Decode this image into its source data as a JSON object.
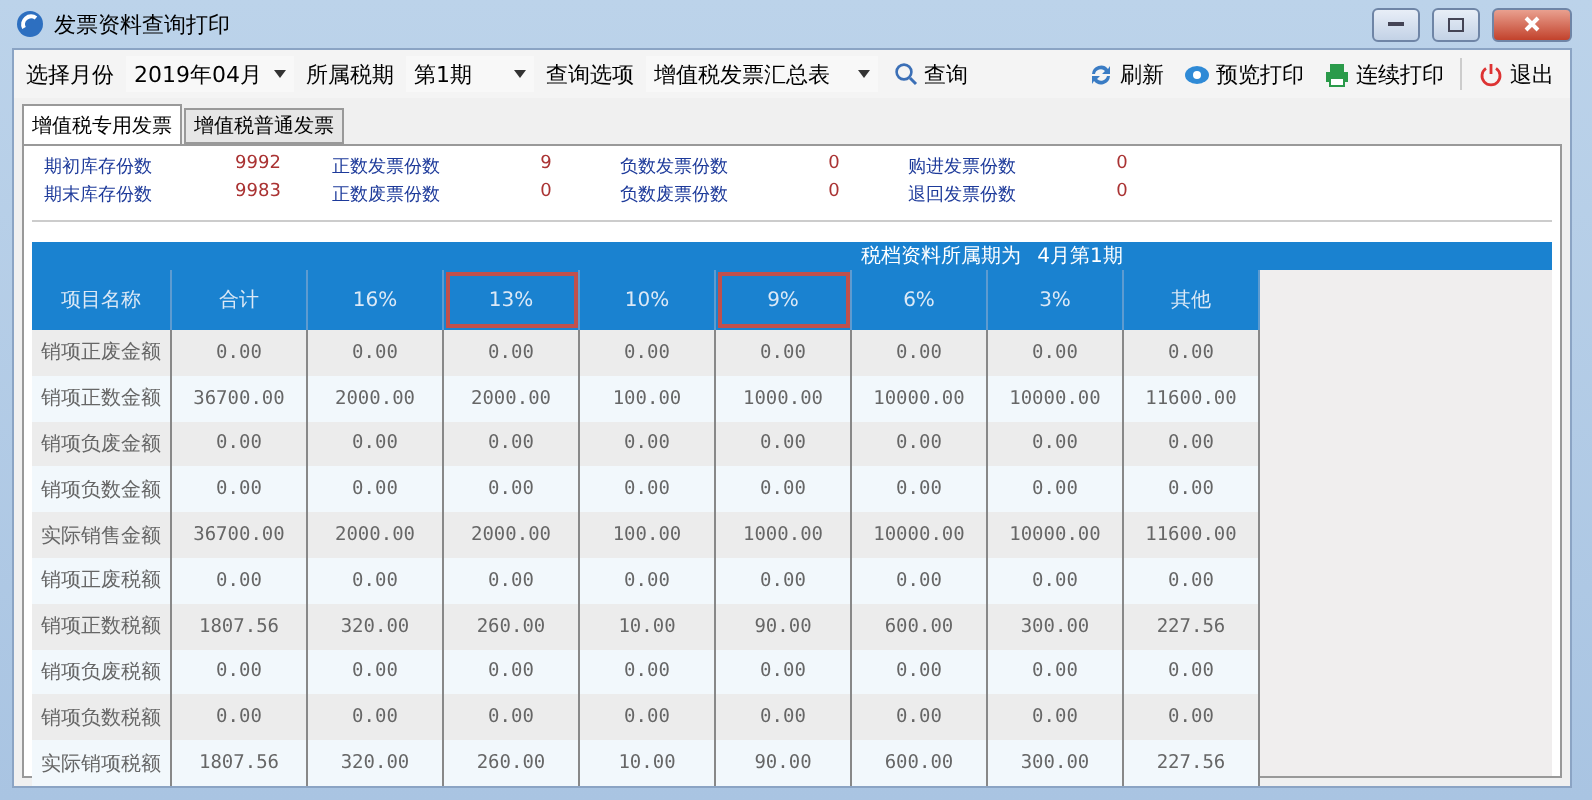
{
  "window": {
    "title": "发票资料查询打印"
  },
  "toolbar": {
    "month_label": "选择月份",
    "month": "2019年04月",
    "period_label": "所属税期",
    "period": "第1期",
    "option_label": "查询选项",
    "option": "增值税发票汇总表",
    "query": "查询",
    "actions": [
      {
        "kind": "refresh",
        "label": "刷新"
      },
      {
        "kind": "preview",
        "label": "预览打印"
      },
      {
        "kind": "print",
        "label": "连续打印"
      },
      {
        "kind": "exit",
        "label": "退出"
      }
    ]
  },
  "tabs": [
    {
      "label": "增值税专用发票",
      "selected": true
    },
    {
      "label": "增值税普通发票",
      "selected": false
    }
  ],
  "summary": [
    [
      {
        "label": "期初库存份数",
        "value": "9992"
      },
      {
        "label": "正数发票份数",
        "value": "9"
      },
      {
        "label": "负数发票份数",
        "value": "0"
      },
      {
        "label": "购进发票份数",
        "value": "0"
      }
    ],
    [
      {
        "label": "期末库存份数",
        "value": "9983"
      },
      {
        "label": "正数废票份数",
        "value": "0"
      },
      {
        "label": "负数废票份数",
        "value": "0"
      },
      {
        "label": "退回发票份数",
        "value": "0"
      }
    ]
  ],
  "table": {
    "caption": "税档资料所属期为",
    "period": "4月第1期",
    "columns": [
      {
        "label": "项目名称",
        "highlighted": false
      },
      {
        "label": "合计",
        "highlighted": false
      },
      {
        "label": "16%",
        "highlighted": false
      },
      {
        "label": "13%",
        "highlighted": true
      },
      {
        "label": "10%",
        "highlighted": false
      },
      {
        "label": "9%",
        "highlighted": true
      },
      {
        "label": "6%",
        "highlighted": false
      },
      {
        "label": "3%",
        "highlighted": false
      },
      {
        "label": "其他",
        "highlighted": false
      }
    ],
    "rows": [
      [
        "销项正废金额",
        "0.00",
        "0.00",
        "0.00",
        "0.00",
        "0.00",
        "0.00",
        "0.00",
        "0.00"
      ],
      [
        "销项正数金额",
        "36700.00",
        "2000.00",
        "2000.00",
        "100.00",
        "1000.00",
        "10000.00",
        "10000.00",
        "11600.00"
      ],
      [
        "销项负废金额",
        "0.00",
        "0.00",
        "0.00",
        "0.00",
        "0.00",
        "0.00",
        "0.00",
        "0.00"
      ],
      [
        "销项负数金额",
        "0.00",
        "0.00",
        "0.00",
        "0.00",
        "0.00",
        "0.00",
        "0.00",
        "0.00"
      ],
      [
        "实际销售金额",
        "36700.00",
        "2000.00",
        "2000.00",
        "100.00",
        "1000.00",
        "10000.00",
        "10000.00",
        "11600.00"
      ],
      [
        "销项正废税额",
        "0.00",
        "0.00",
        "0.00",
        "0.00",
        "0.00",
        "0.00",
        "0.00",
        "0.00"
      ],
      [
        "销项正数税额",
        "1807.56",
        "320.00",
        "260.00",
        "10.00",
        "90.00",
        "600.00",
        "300.00",
        "227.56"
      ],
      [
        "销项负废税额",
        "0.00",
        "0.00",
        "0.00",
        "0.00",
        "0.00",
        "0.00",
        "0.00",
        "0.00"
      ],
      [
        "销项负数税额",
        "0.00",
        "0.00",
        "0.00",
        "0.00",
        "0.00",
        "0.00",
        "0.00",
        "0.00"
      ],
      [
        "实际销项税额",
        "1807.56",
        "320.00",
        "260.00",
        "10.00",
        "90.00",
        "600.00",
        "300.00",
        "227.56"
      ]
    ]
  }
}
